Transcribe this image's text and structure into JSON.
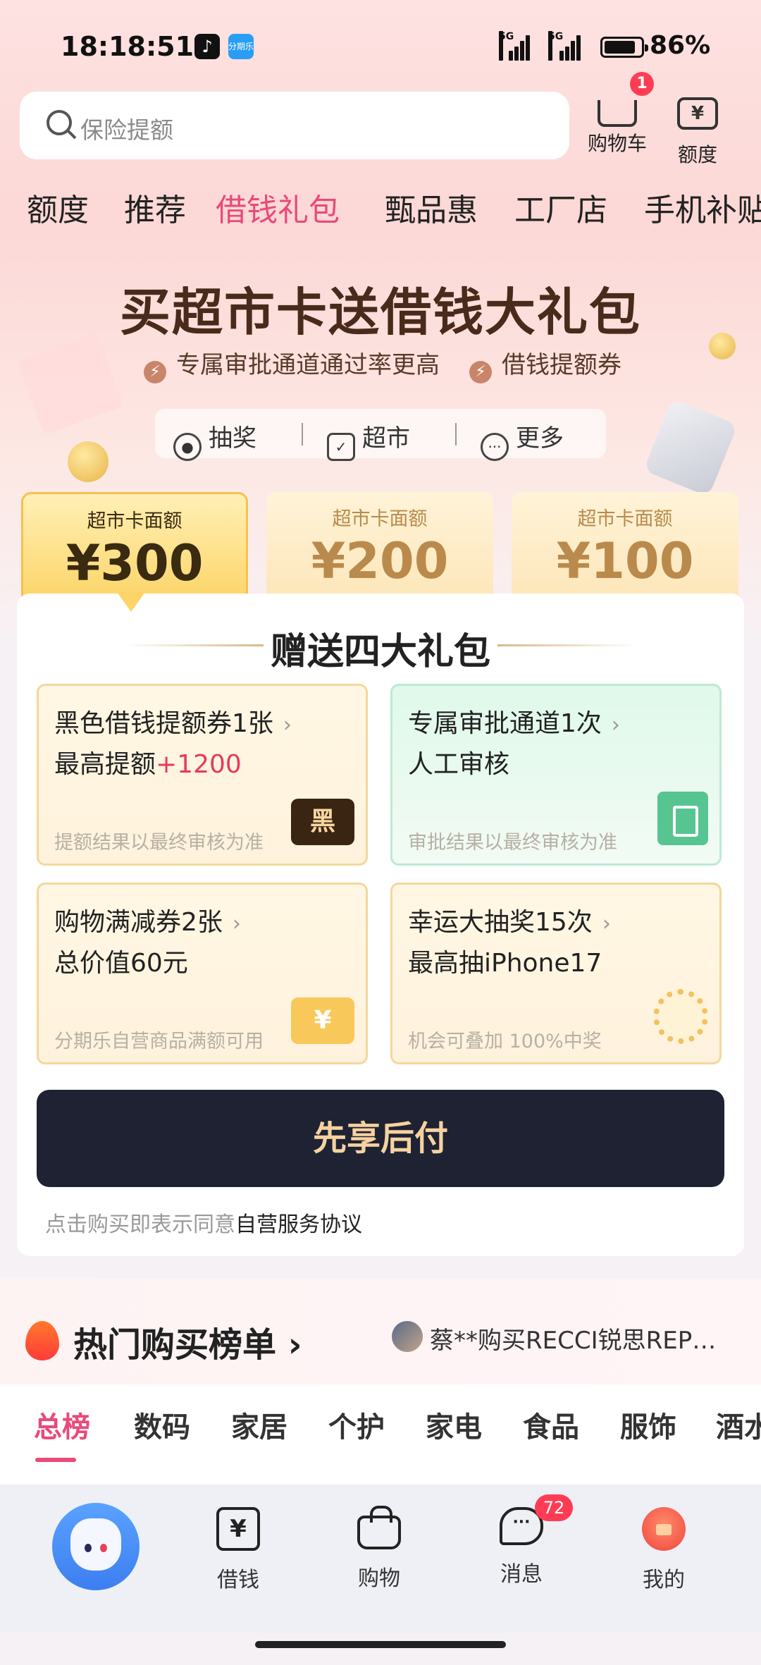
{
  "status_bar": {
    "time": "18:18:51",
    "signal1": "5G",
    "signal2": "5G",
    "battery": "86%",
    "battery_level": 0.86
  },
  "search": {
    "placeholder": "保险提额"
  },
  "header_icons": [
    {
      "icon": "cart-icon",
      "label": "购物车",
      "badge": "1"
    },
    {
      "icon": "wallet-icon",
      "label": "额度"
    }
  ],
  "category_tabs": [
    "额度",
    "推荐",
    "借钱礼包",
    "甄品惠",
    "工厂店",
    "手机补贴"
  ],
  "active_category": "借钱礼包",
  "banner": {
    "title": "买超市卡送借钱大礼包",
    "sub1": "专属审批通道通过率更高",
    "sub2": "借钱提额券",
    "quick_links": [
      "抽奖",
      "超市",
      "更多"
    ]
  },
  "amount_cards": [
    {
      "label": "超市卡面额",
      "value": "¥300",
      "selected": true
    },
    {
      "label": "超市卡面额",
      "value": "¥200",
      "selected": false
    },
    {
      "label": "超市卡面额",
      "value": "¥100",
      "selected": false
    }
  ],
  "gift_panel": {
    "title": "赠送四大礼包",
    "gifts": [
      {
        "line1": "黑色借钱提额券1张",
        "line2": "最高提额",
        "highlight": "+1200",
        "note": "提额结果以最终审核为准",
        "icon": "black-ticket-icon",
        "icon_text": "黑"
      },
      {
        "line1": "专属审批通道1次",
        "line2": "人工审核",
        "highlight": "",
        "note": "审批结果以最终审核为准",
        "icon": "stamp-icon",
        "icon_text": ""
      },
      {
        "line1": "购物满减券2张",
        "line2": "总价值60元",
        "highlight": "",
        "note": "分期乐自营商品满额可用",
        "icon": "coupon-icon",
        "icon_text": "¥"
      },
      {
        "line1": "幸运大抽奖15次",
        "line2": "最高抽iPhone17",
        "highlight": "",
        "note": "机会可叠加 100%中奖",
        "icon": "lucky-wheel-icon",
        "icon_text": ""
      }
    ],
    "chevron": "›",
    "cta": "先享后付",
    "agreement_prefix": "点击购买即表示同意",
    "agreement_link": "自营服务协议"
  },
  "hot_list": {
    "title": "热门购买榜单",
    "arrow": "›",
    "ticker": "蔡**购买RECCI锐思REP…"
  },
  "rank_tabs": [
    "总榜",
    "数码",
    "家居",
    "个护",
    "家电",
    "食品",
    "服饰",
    "酒水"
  ],
  "active_rank_tab": "总榜",
  "bottom_nav": [
    {
      "icon": "mascot-home-icon",
      "label": ""
    },
    {
      "icon": "loan-icon",
      "label": "借钱",
      "glyph": "¥"
    },
    {
      "icon": "shopping-bag-icon",
      "label": "购物"
    },
    {
      "icon": "message-icon",
      "label": "消息",
      "badge": "72",
      "glyph": "···"
    },
    {
      "icon": "red-envelope-icon",
      "label": "我的"
    }
  ],
  "colors": {
    "accent": "#e84a7a",
    "cta_bg": "#1e2233",
    "cta_text": "#f6d2a0",
    "gold": "#fcd467",
    "highlight_red": "#e83a5a"
  }
}
